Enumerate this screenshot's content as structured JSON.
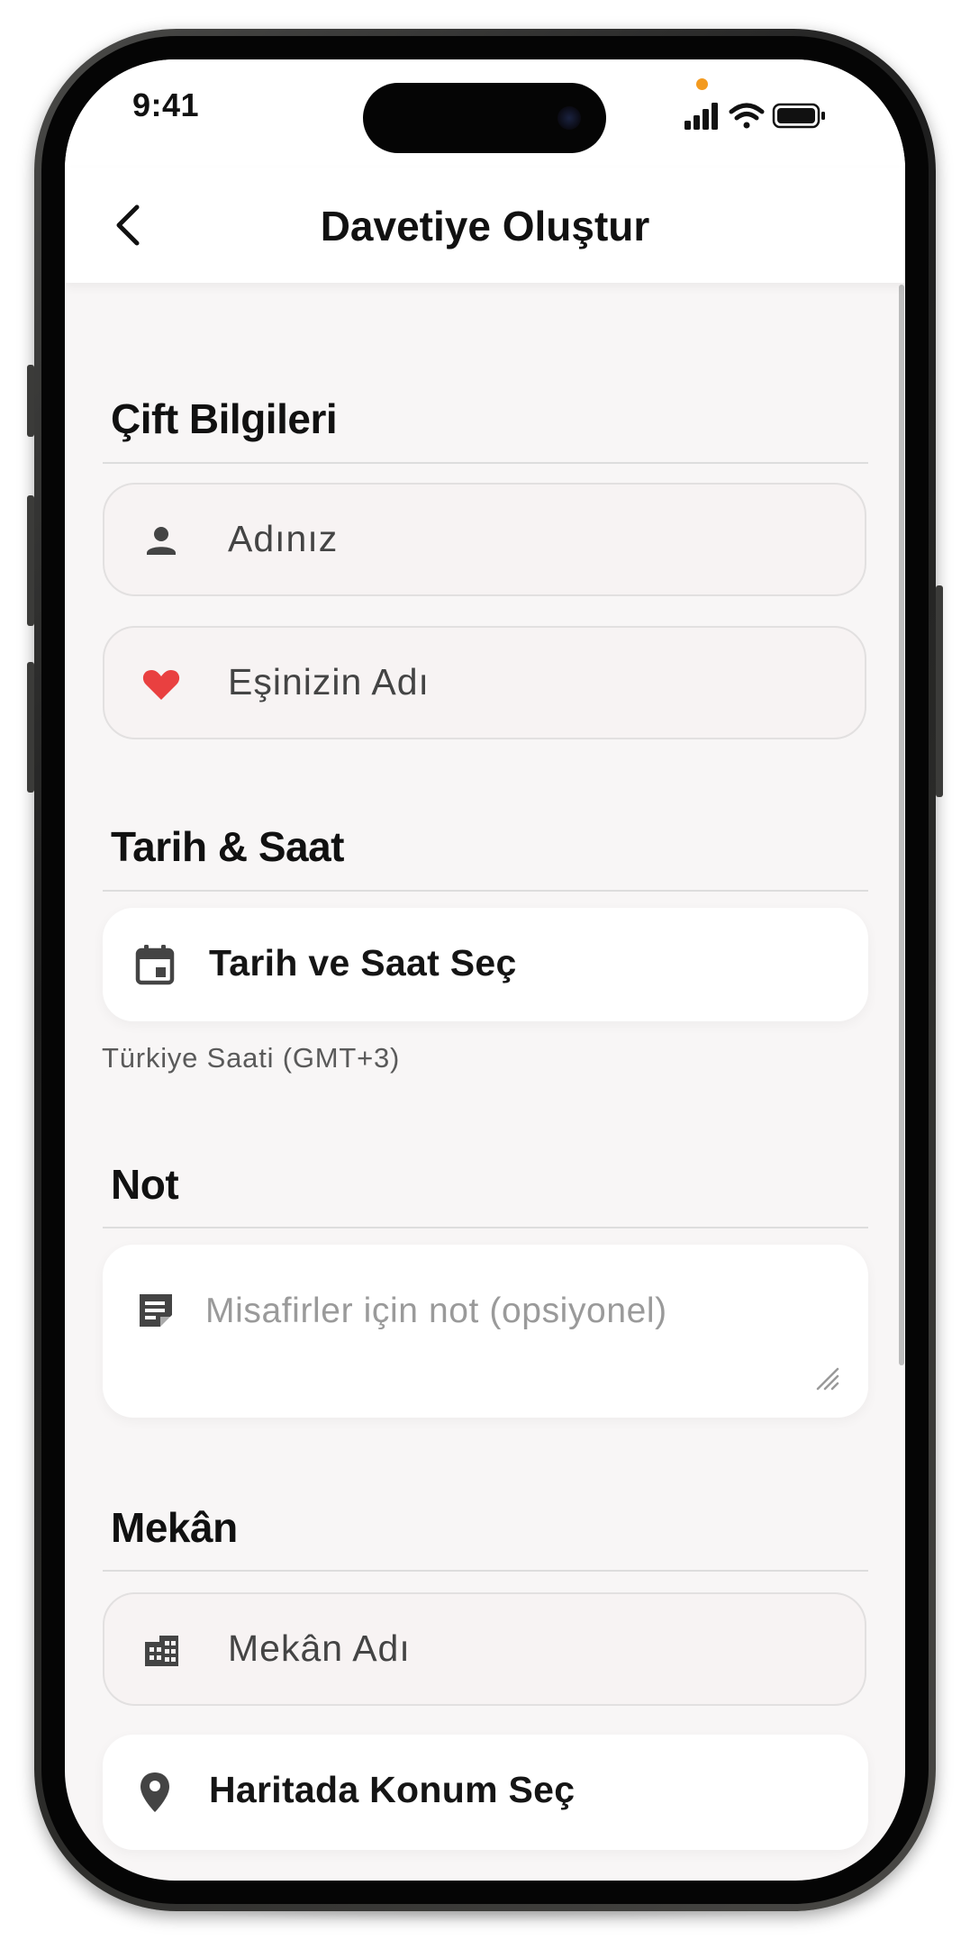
{
  "status_bar": {
    "time": "9:41"
  },
  "header": {
    "title": "Davetiye Oluştur"
  },
  "sections": {
    "couple": {
      "title": "Çift Bilgileri",
      "name_placeholder": "Adınız",
      "partner_placeholder": "Eşinizin Adı"
    },
    "datetime": {
      "title": "Tarih & Saat",
      "pick_label": "Tarih ve Saat Seç",
      "timezone_note": "Türkiye Saati (GMT+3)"
    },
    "note": {
      "title": "Not",
      "placeholder": "Misafirler için not (opsiyonel)"
    },
    "venue": {
      "title": "Mekân",
      "name_placeholder": "Mekân Adı",
      "map_label": "Haritada Konum Seç"
    }
  },
  "colors": {
    "heart": "#e94040",
    "icon": "#444444",
    "privacy_indicator": "#f39a1f"
  },
  "icons": {
    "back": "chevron-left-icon",
    "name": "person-icon",
    "partner": "heart-icon",
    "calendar": "calendar-icon",
    "note": "note-icon",
    "venue": "building-icon",
    "map": "location-pin-icon"
  }
}
